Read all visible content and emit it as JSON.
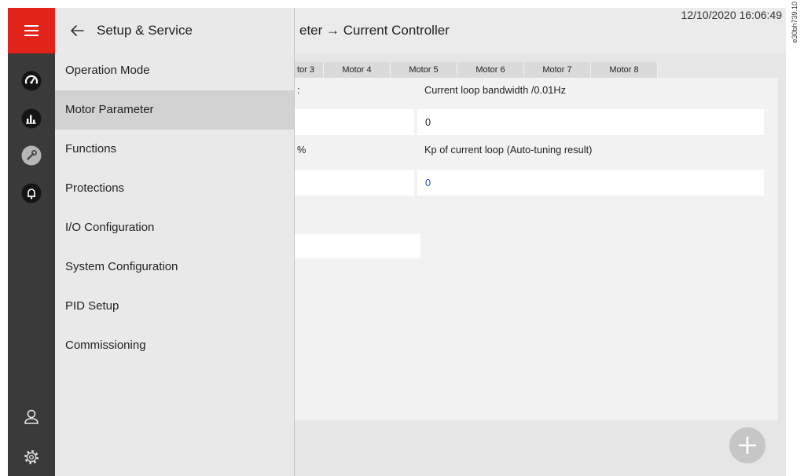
{
  "colors": {
    "accent": "#e2231a",
    "sidebar": "#3a3a3a",
    "menu_background": "#e9e9e9",
    "menu_active": "#d2d2d2",
    "value_highlight": "#1f4fbf",
    "fab": "#c6c6c6"
  },
  "sidebar": {
    "menu_icon": "hamburger-icon",
    "nav_icons": [
      "dashboard-icon",
      "chart-icon",
      "wrench-icon",
      "bell-icon"
    ],
    "active_nav_icon": "wrench-icon",
    "bottom_icons": [
      "user-icon",
      "gear-icon"
    ]
  },
  "menu": {
    "back_icon": "arrow-left-icon",
    "title": "Setup & Service",
    "items": [
      {
        "label": "Operation Mode",
        "active": false
      },
      {
        "label": "Motor Parameter",
        "active": true
      },
      {
        "label": "Functions",
        "active": false
      },
      {
        "label": "Protections",
        "active": false
      },
      {
        "label": "I/O Configuration",
        "active": false
      },
      {
        "label": "System Configuration",
        "active": false
      },
      {
        "label": "PID Setup",
        "active": false
      },
      {
        "label": "Commissioning",
        "active": false
      }
    ]
  },
  "header": {
    "breadcrumb": "eter → Current Controller",
    "timestamp": "12/10/2020 16:06:49"
  },
  "tabs": [
    {
      "label": "tor 3"
    },
    {
      "label": "Motor 4"
    },
    {
      "label": "Motor 5"
    },
    {
      "label": "Motor 6"
    },
    {
      "label": "Motor 7"
    },
    {
      "label": "Motor 8"
    }
  ],
  "form": {
    "row1": {
      "left_label": ":",
      "right_label": "Current loop bandwidth /0.01Hz",
      "right_value": "0"
    },
    "row2": {
      "left_label": "%",
      "right_label": "Kp of current loop (Auto-tuning result)",
      "right_value": "0"
    }
  },
  "fab_icon": "plus-icon",
  "figure_id": "e30bh739.10"
}
